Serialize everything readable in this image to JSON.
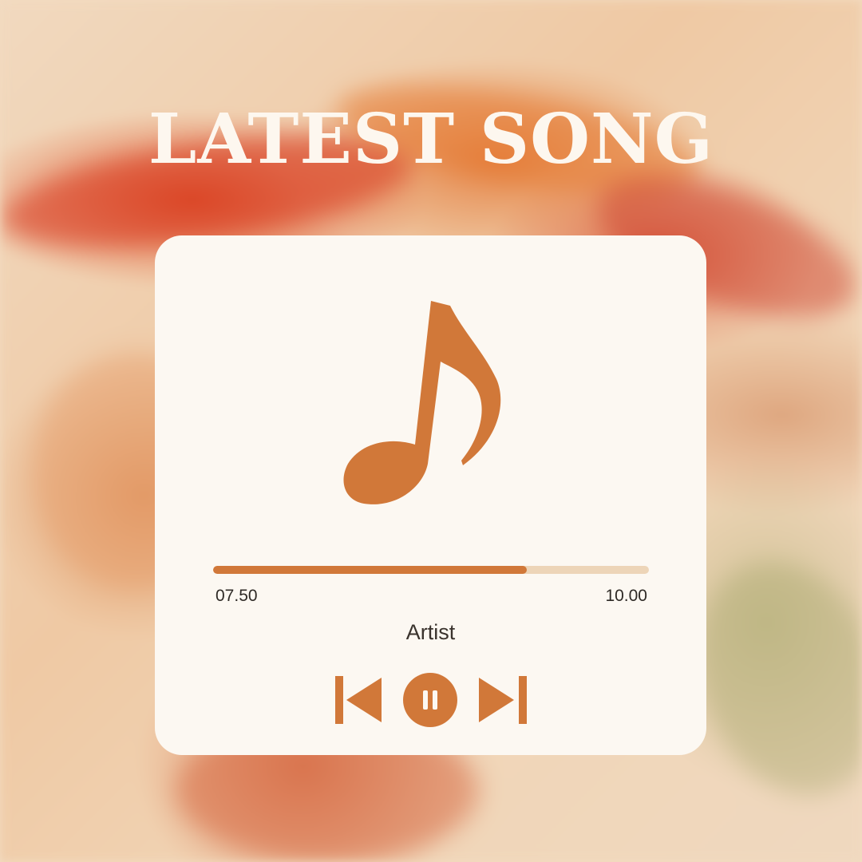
{
  "page": {
    "title": "LATEST SONG"
  },
  "player": {
    "current_time": "07.50",
    "total_time": "10.00",
    "artist": "Artist",
    "progress_fraction": 0.72,
    "icons": {
      "cover": "music-note-icon",
      "previous": "skip-previous-icon",
      "pause": "pause-icon",
      "next": "skip-next-icon"
    }
  },
  "colors": {
    "accent": "#d17839",
    "track": "#edd5b8",
    "card": "#fcf8f2",
    "title": "#fdf7ef",
    "text": "#2e2a26"
  }
}
